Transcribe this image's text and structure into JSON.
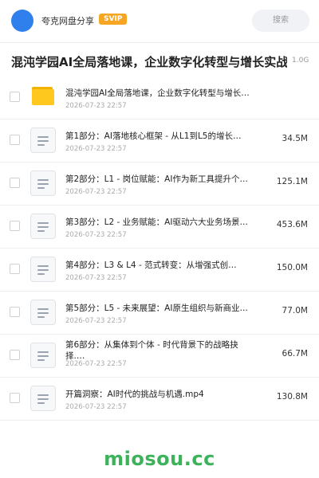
{
  "header": {
    "owner_name": "夸克网盘分享",
    "badge": "SVIP",
    "search_placeholder": "搜索"
  },
  "title": {
    "text": "混沌学园AI全局落地课，企业数字化转型与增长实战",
    "size": "1.0G"
  },
  "files": [
    {
      "type": "folder",
      "name": "混沌学园AI全局落地课，企业数字化转型与增长实战",
      "date": "2026-07-23 22:57",
      "size": ""
    },
    {
      "type": "file",
      "name": "第1部分：AI落地核心框架 - 从L1到L5的增长…",
      "date": "2026-07-23 22:57",
      "size": "34.5M"
    },
    {
      "type": "file",
      "name": "第2部分：L1 - 岗位赋能：AI作为新工具提升个…",
      "date": "2026-07-23 22:57",
      "size": "125.1M"
    },
    {
      "type": "file",
      "name": "第3部分：L2 - 业务赋能：AI驱动六大业务场景…",
      "date": "2026-07-23 22:57",
      "size": "453.6M"
    },
    {
      "type": "file",
      "name": "第4部分：L3 & L4 - 范式转变：从增强式创…",
      "date": "2026-07-23 22:57",
      "size": "150.0M"
    },
    {
      "type": "file",
      "name": "第5部分：L5 - 未来展望：AI原生组织与新商业…",
      "date": "2026-07-23 22:57",
      "size": "77.0M"
    },
    {
      "type": "file",
      "name": "第6部分：从集体到个体 - 时代背景下的战略抉择.…",
      "date": "2026-07-23 22:57",
      "size": "66.7M"
    },
    {
      "type": "file",
      "name": "开篇洞察：AI时代的挑战与机遇.mp4",
      "date": "2026-07-23 22:57",
      "size": "130.8M"
    }
  ],
  "watermark": "miosou.cc",
  "colors": {
    "avatar": "#2f80ed",
    "badge": "#f6a623",
    "folder": "#ffc81f",
    "watermark": "#3cb35a"
  }
}
